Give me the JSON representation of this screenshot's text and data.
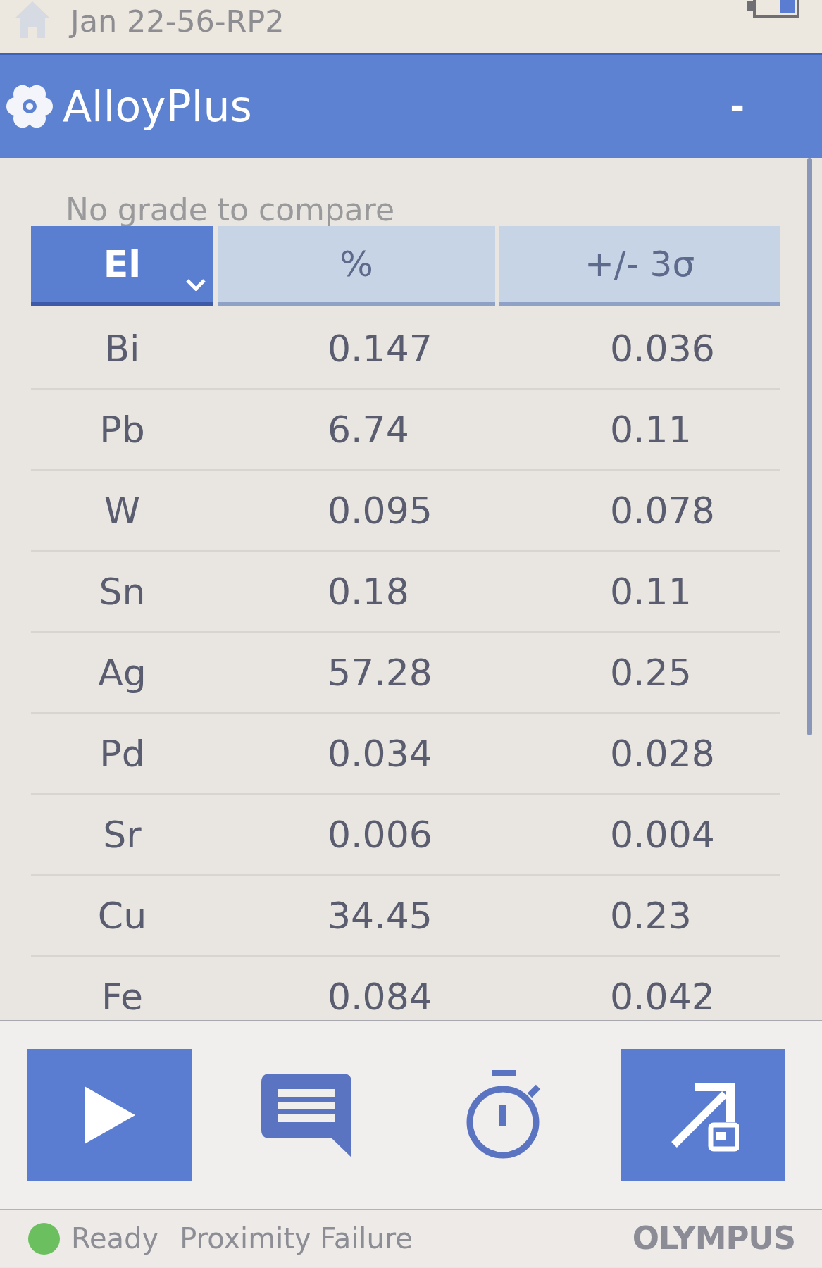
{
  "top_bar": {
    "title": "Jan 22-56-RP2"
  },
  "app_bar": {
    "title": "AlloyPlus",
    "minimize": "-"
  },
  "grade_message": "No grade to compare",
  "table": {
    "columns": [
      {
        "label": "El",
        "selected": true
      },
      {
        "label": "%",
        "selected": false
      },
      {
        "label": "+/- 3σ",
        "selected": false
      }
    ],
    "rows": [
      {
        "element": "Bi",
        "percent": "0.147",
        "error": "0.036"
      },
      {
        "element": "Pb",
        "percent": "6.74",
        "error": "0.11"
      },
      {
        "element": "W",
        "percent": "0.095",
        "error": "0.078"
      },
      {
        "element": "Sn",
        "percent": "0.18",
        "error": "0.11"
      },
      {
        "element": "Ag",
        "percent": "57.28",
        "error": "0.25"
      },
      {
        "element": "Pd",
        "percent": "0.034",
        "error": "0.028"
      },
      {
        "element": "Sr",
        "percent": "0.006",
        "error": "0.004"
      },
      {
        "element": "Cu",
        "percent": "34.45",
        "error": "0.23"
      },
      {
        "element": "Fe",
        "percent": "0.084",
        "error": "0.042"
      }
    ]
  },
  "toolbar": [
    {
      "kind": "start",
      "highlighted": true
    },
    {
      "kind": "notes",
      "highlighted": false
    },
    {
      "kind": "timer",
      "highlighted": false
    },
    {
      "kind": "export",
      "highlighted": true
    }
  ],
  "status_bar": {
    "ready": true,
    "status": "Ready",
    "message": "Proximity Failure",
    "brand": "OLYMPUS"
  }
}
